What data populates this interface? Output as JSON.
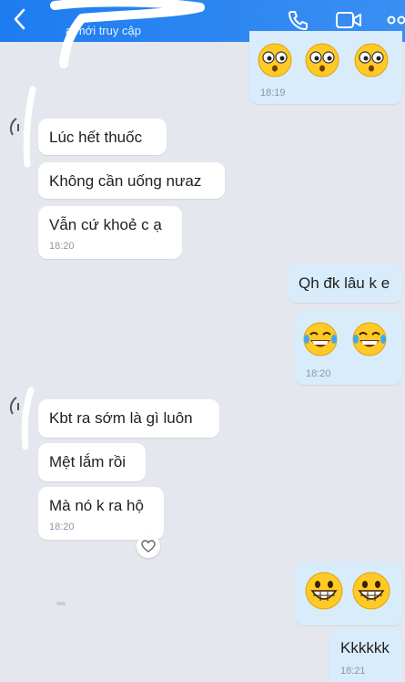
{
  "header": {
    "status_text": "a mới truy cập",
    "icons": [
      "back-arrow-icon",
      "phone-icon",
      "video-call-icon",
      "more-options-icon"
    ]
  },
  "colors": {
    "header": "#2a84f1",
    "background": "#e4e7ee",
    "incoming_bubble": "#ffffff",
    "outgoing_bubble": "#d9ecfc"
  },
  "messages": {
    "m0_time": "18:19",
    "m1_text": "Lúc hết thuốc",
    "m2_text": "Không cần uống nưaz",
    "m3_text": "Vẫn cứ khoẻ c ạ",
    "m3_time": "18:20",
    "m4_text": "Qh đk lâu k e",
    "m5_time": "18:20",
    "m6_text": "Kbt ra sớm là gì luôn",
    "m7_text": "Mệt lắm rồi",
    "m8_text": "Mà nó k ra hộ",
    "m8_time": "18:20",
    "m10_text": "Kkkkkk",
    "m10_time": "18:21"
  }
}
